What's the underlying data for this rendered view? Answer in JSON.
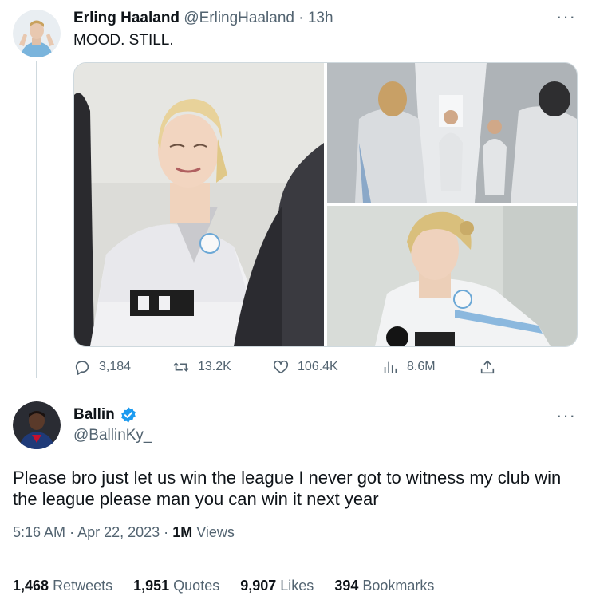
{
  "tweet1": {
    "author_name": "Erling Haaland",
    "author_handle": "@ErlingHaaland",
    "separator": "·",
    "time": "13h",
    "more": "···",
    "text": "MOOD. STILL.",
    "images": [
      "photo-smiling-training-jacket",
      "photo-tunnel-walking",
      "photo-side-smile"
    ],
    "actions": {
      "replies": "3,184",
      "retweets": "13.2K",
      "likes": "106.4K",
      "views": "8.6M"
    }
  },
  "tweet2": {
    "author_name": "Ballin",
    "author_handle": "@BallinKy_",
    "verified": true,
    "more": "···",
    "text": "Please bro just let us win the league I never got to witness my club win the league please man you can win it next year",
    "time": "5:16 AM",
    "separator": "·",
    "date": "Apr 22, 2023",
    "views_count": "1M",
    "views_label": "Views",
    "stats": [
      {
        "num": "1,468",
        "label": "Retweets"
      },
      {
        "num": "1,951",
        "label": "Quotes"
      },
      {
        "num": "9,907",
        "label": "Likes"
      },
      {
        "num": "394",
        "label": "Bookmarks"
      }
    ]
  },
  "colors": {
    "text_primary": "#0f1419",
    "text_secondary": "#536471",
    "verified_blue": "#1d9bf0",
    "divider": "#eff3f4"
  }
}
